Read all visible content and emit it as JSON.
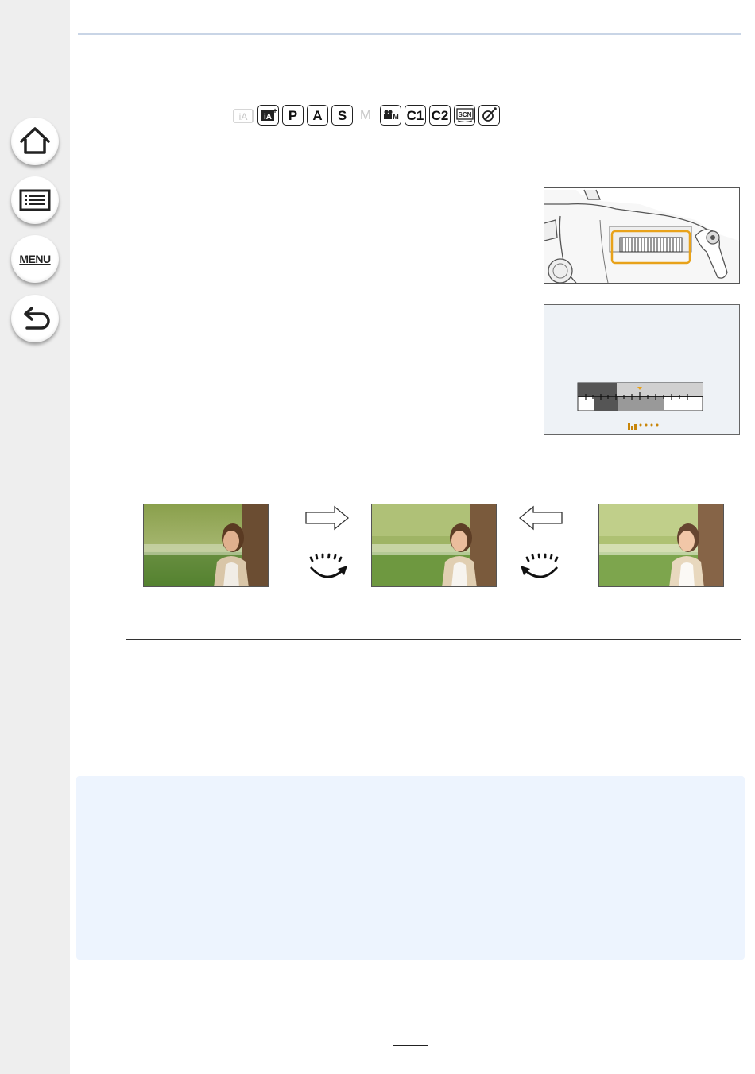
{
  "sidebar": {
    "items": [
      {
        "id": "home",
        "icon": "home-icon"
      },
      {
        "id": "contents",
        "icon": "list-icon"
      },
      {
        "id": "menu",
        "label": "MENU"
      },
      {
        "id": "back",
        "icon": "back-arrow-icon"
      }
    ]
  },
  "modes": [
    {
      "label": "iA",
      "available": false
    },
    {
      "label": "iA+",
      "available": true
    },
    {
      "label": "P",
      "available": true
    },
    {
      "label": "A",
      "available": true
    },
    {
      "label": "S",
      "available": true
    },
    {
      "label": "M",
      "available": false
    },
    {
      "label": "M",
      "available": true
    },
    {
      "label": "C1",
      "available": true
    },
    {
      "label": "C2",
      "available": true
    },
    {
      "label": "SCN",
      "available": true
    },
    {
      "label": "creative",
      "available": true
    }
  ],
  "figures": {
    "camera_dial": {
      "highlight_color": "#e8a21a"
    },
    "exposure_scale": {
      "accent_color": "#e8a21a"
    }
  },
  "comparison": {
    "arrows": [
      "right-arrow",
      "left-arrow"
    ],
    "dials": [
      "dial-rotate-right",
      "dial-rotate-left"
    ]
  },
  "page": {
    "number": ""
  },
  "colors": {
    "note_background": "#edf4fe",
    "rule": "#c9d5e6",
    "sidebar": "#eeeeee"
  }
}
